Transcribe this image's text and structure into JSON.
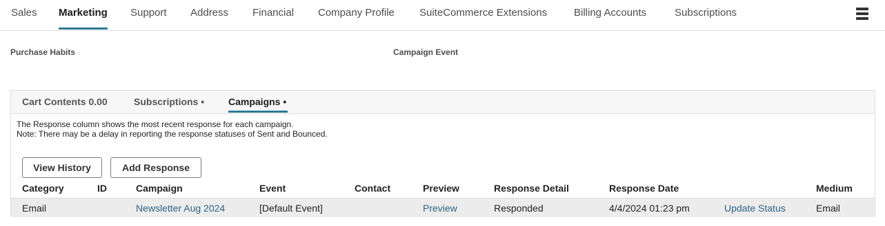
{
  "nav": {
    "tabs": [
      {
        "label": "Sales"
      },
      {
        "label": "Marketing"
      },
      {
        "label": "Support"
      },
      {
        "label": "Address"
      },
      {
        "label": "Financial"
      },
      {
        "label": "Company Profile"
      },
      {
        "label": "SuiteCommerce Extensions"
      },
      {
        "label": "Billing Accounts"
      },
      {
        "label": "Subscriptions"
      }
    ],
    "active_tab": "Marketing",
    "menu_icon": "list-icon"
  },
  "fields": {
    "purchase_habits_label": "Purchase Habits",
    "campaign_event_label": "Campaign Event"
  },
  "subtabs": {
    "items": [
      {
        "label": "Cart Contents 0.00"
      },
      {
        "label": "Subscriptions •"
      },
      {
        "label": "Campaigns •"
      }
    ],
    "active": "Campaigns •"
  },
  "campaigns": {
    "note_line1": "The Response column shows the most recent response for each campaign.",
    "note_line2": "Note: There may be a delay in reporting the response statuses of Sent and Bounced.",
    "view_history_label": "View History",
    "add_response_label": "Add Response",
    "columns": [
      "Category",
      "ID",
      "Campaign",
      "Event",
      "Contact",
      "Preview",
      "Response Detail",
      "Response Date",
      "",
      "Medium"
    ],
    "rows": [
      {
        "category": "Email",
        "id": "",
        "campaign": "Newsletter Aug 2024",
        "event": "[Default Event]",
        "contact": "",
        "preview": "Preview",
        "response_detail": "Responded",
        "response_date": "4/4/2024 01:23 pm",
        "action": "Update Status",
        "medium": "Email"
      }
    ]
  },
  "colors": {
    "accent": "#2c7a95",
    "link": "#2e6387",
    "row_bg": "#ececec"
  }
}
